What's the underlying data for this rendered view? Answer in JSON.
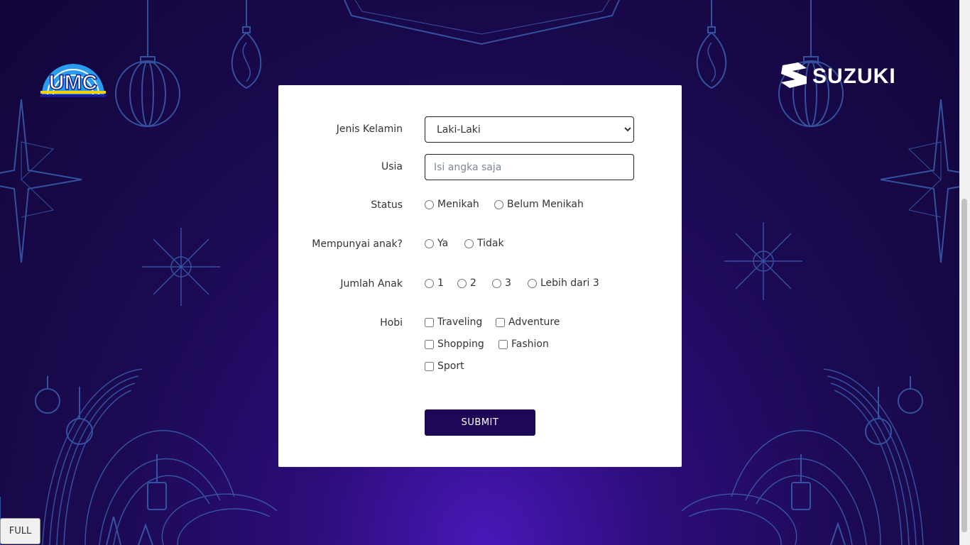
{
  "branding": {
    "left_logo": "UMC",
    "right_logo": "SUZUKI"
  },
  "form": {
    "gender": {
      "label": "Jenis Kelamin",
      "selected": "Laki-Laki"
    },
    "age": {
      "label": "Usia",
      "value": "",
      "placeholder": "Isi angka saja"
    },
    "status": {
      "label": "Status",
      "options": [
        "Menikah",
        "Belum Menikah"
      ]
    },
    "has_children": {
      "label": "Mempunyai anak?",
      "options": [
        "Ya",
        "Tidak"
      ]
    },
    "children_count": {
      "label": "Jumlah Anak",
      "options": [
        "1",
        "2",
        "3",
        "Lebih dari 3"
      ]
    },
    "hobbies": {
      "label": "Hobi",
      "options": [
        "Traveling",
        "Adventure",
        "Shopping",
        "Fashion",
        "Sport"
      ]
    },
    "submit_label": "SUBMIT"
  },
  "full_button_label": "FULL",
  "colors": {
    "background": "#1b0a52",
    "submit_button": "#1d0757",
    "ornament_line": "#3a5fb0"
  }
}
